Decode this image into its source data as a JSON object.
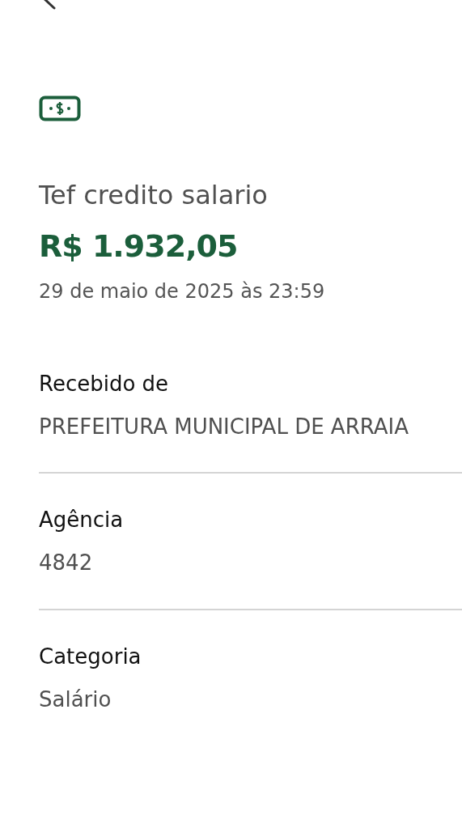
{
  "transaction": {
    "description": "Tef credito salario",
    "amount": "R$ 1.932,05",
    "date": "29 de maio de 2025 às 23:59"
  },
  "fields": [
    {
      "label": "Recebido de",
      "value": "PREFEITURA MUNICIPAL DE ARRAIA"
    },
    {
      "label": "Agência",
      "value": "4842"
    },
    {
      "label": "Categoria",
      "value": "Salário"
    }
  ]
}
